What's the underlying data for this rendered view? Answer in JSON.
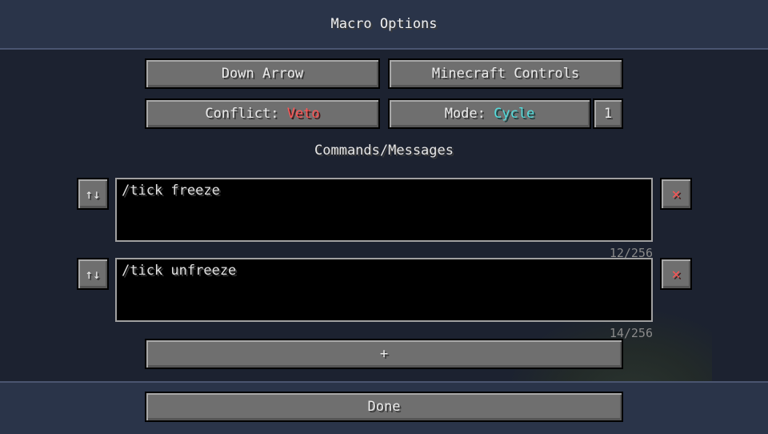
{
  "title": "Macro Options",
  "key_button": "Down Arrow",
  "controls_button": "Minecraft Controls",
  "conflict": {
    "label": "Conflict: ",
    "value": "Veto"
  },
  "mode": {
    "label": "Mode: ",
    "value": "Cycle"
  },
  "mode_count": "1",
  "section_label": "Commands/Messages",
  "commands": [
    {
      "text": "/tick freeze",
      "counter": "12/256"
    },
    {
      "text": "/tick unfreeze",
      "counter": "14/256"
    }
  ],
  "reorder_icon": "↑↓",
  "delete_icon": "✕",
  "add_label": "+",
  "done_label": "Done",
  "colors": {
    "conflict_value": "#ff5555",
    "mode_value": "#55dddd"
  }
}
